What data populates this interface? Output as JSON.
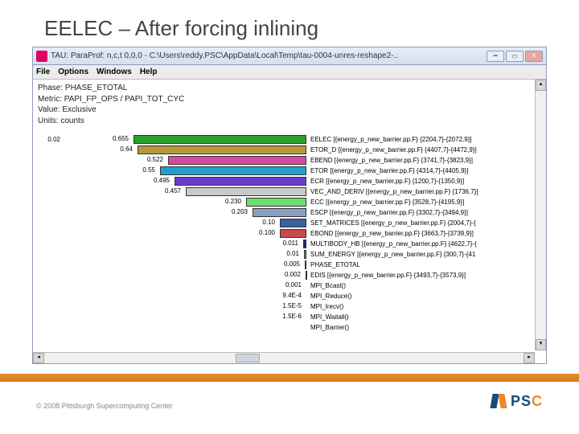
{
  "slide": {
    "title": "EELEC – After forcing inlining"
  },
  "window": {
    "title": "TAU: ParaProf: n,c,t 0,0,0 - C:\\Users\\reddy.PSC\\AppData\\Local\\Temp\\tau-0004-unres-reshape2-..",
    "menus": [
      "File",
      "Options",
      "Windows",
      "Help"
    ]
  },
  "meta": {
    "phase": "Phase: PHASE_ETOTAL",
    "metric": "Metric: PAPI_FP_OPS / PAPI_TOT_CYC",
    "value": "Value: Exclusive",
    "units": "Units: counts"
  },
  "chart_data": {
    "type": "bar",
    "lead_value": "0.02",
    "rows": [
      {
        "value": "0.655",
        "desc": "EELEC [{energy_p_new_barrier.pp.F} {2204,7}-{2072,9}]",
        "color": "#2aa02a",
        "bar": 215
      },
      {
        "value": "0.64",
        "desc": "ETOR_D [{energy_p_new_barrier.pp.F} {4407,7}-{4472,9}]",
        "color": "#b59a3a",
        "bar": 210
      },
      {
        "value": "0.522",
        "desc": "EBEND [{energy_p_new_barrier.pp.F} {3741,7}-{3823,9}]",
        "color": "#d84aa0",
        "bar": 172
      },
      {
        "value": "0.55",
        "desc": "ETOR [{energy_p_new_barrier.pp.F} {4314,7}-{4405,9}]",
        "color": "#20a0d0",
        "bar": 182
      },
      {
        "value": "0.495",
        "desc": "ECR [{energy_p_new_barrier.pp.F} {1200,7}-{1350,9}]",
        "color": "#6a3dcc",
        "bar": 164
      },
      {
        "value": "0.457",
        "desc": "VEC_AND_DERIV [{energy_p_new_barrier.pp.F} {1736,7}]",
        "color": "#c9c9c9",
        "bar": 150
      },
      {
        "value": "0.230",
        "desc": "ECC [{energy_p_new_barrier.pp.F} {3528,7}-{4195,9}]",
        "color": "#6be06b",
        "bar": 75
      },
      {
        "value": "0.203",
        "desc": "ESCP [{energy_p_new_barrier.pp.F} {3302,7}-{3494,9}]",
        "color": "#8aa0c0",
        "bar": 67
      },
      {
        "value": "0.10",
        "desc": "SET_MATRICES [{energy_p_new_barrier.pp.F} {2004,7}-{",
        "color": "#3a60a0",
        "bar": 33
      },
      {
        "value": "0.100",
        "desc": "EBOND [{energy_p_new_barrier.pp.F} {3663,7}-{3739,9}]",
        "color": "#c94a4a",
        "bar": 33
      },
      {
        "value": "0.011",
        "desc": "MULTIBODY_HB [{energy_p_new_barrier.pp.F} {4622,7}-{",
        "color": "#1a2a7a",
        "bar": 4
      },
      {
        "value": "0.01",
        "desc": "SUM_ENERGY [{energy_p_new_barrier.pp.F} {300,7}-{41",
        "color": "#20a0d0",
        "bar": 3
      },
      {
        "value": "0.005",
        "desc": "PHASE_ETOTAL",
        "color": "#20a0d0",
        "bar": 2
      },
      {
        "value": "0.002",
        "desc": "EDIS [{energy_p_new_barrier.pp.F} {3493,7}-{3573,9}]",
        "color": "#c9c9c9",
        "bar": 1
      },
      {
        "value": "0.001",
        "desc": "MPI_Bcast()",
        "color": "#c9c9c9",
        "bar": 0
      },
      {
        "value": "9.4E-4",
        "desc": "MPI_Reduce()",
        "color": "#c9c9c9",
        "bar": 0
      },
      {
        "value": "1.5E-5",
        "desc": "MPI_Irecv()",
        "color": "#c9c9c9",
        "bar": 0
      },
      {
        "value": "1.5E-6",
        "desc": "MPI_Waitall()",
        "color": "#c9c9c9",
        "bar": 0
      },
      {
        "value": "",
        "desc": "MPI_Barrier()",
        "color": "#c9c9c9",
        "bar": 0
      }
    ]
  },
  "footer": {
    "copyright": "© 2008 Pittsburgh Supercomputing Center",
    "logo_text": "PSC"
  }
}
